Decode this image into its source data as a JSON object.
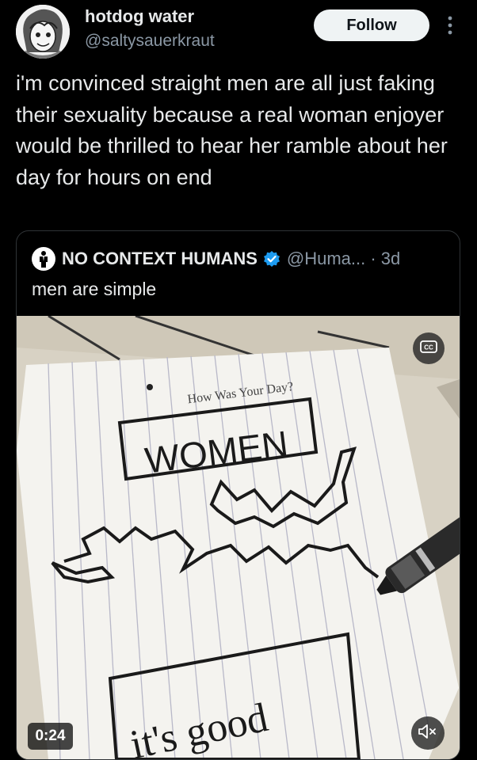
{
  "author": {
    "name": "hotdog water",
    "handle": "@saltysauerkraut"
  },
  "follow_label": "Follow",
  "tweet_text": "i'm convinced straight men are all just faking their sexuality because a real woman enjoyer would be thrilled to hear her ramble about her day for hours on end",
  "quote": {
    "name": "NO CONTEXT HUMANS",
    "handle_time": "@Huma... · 3d",
    "text": "men are simple",
    "video": {
      "duration": "0:24",
      "drawing_caption": "How Was Your Day?",
      "box_word": "WOMEN",
      "bottom_word": "it's good"
    }
  },
  "colors": {
    "background": "#000000",
    "text": "#e7e9ea",
    "secondary": "#8b98a5",
    "verified": "#1d9bf0",
    "follow_bg": "#eff3f4"
  },
  "icons": [
    "more-options-icon",
    "verified-badge-icon",
    "cc-icon",
    "mute-icon",
    "person-logo-icon"
  ]
}
